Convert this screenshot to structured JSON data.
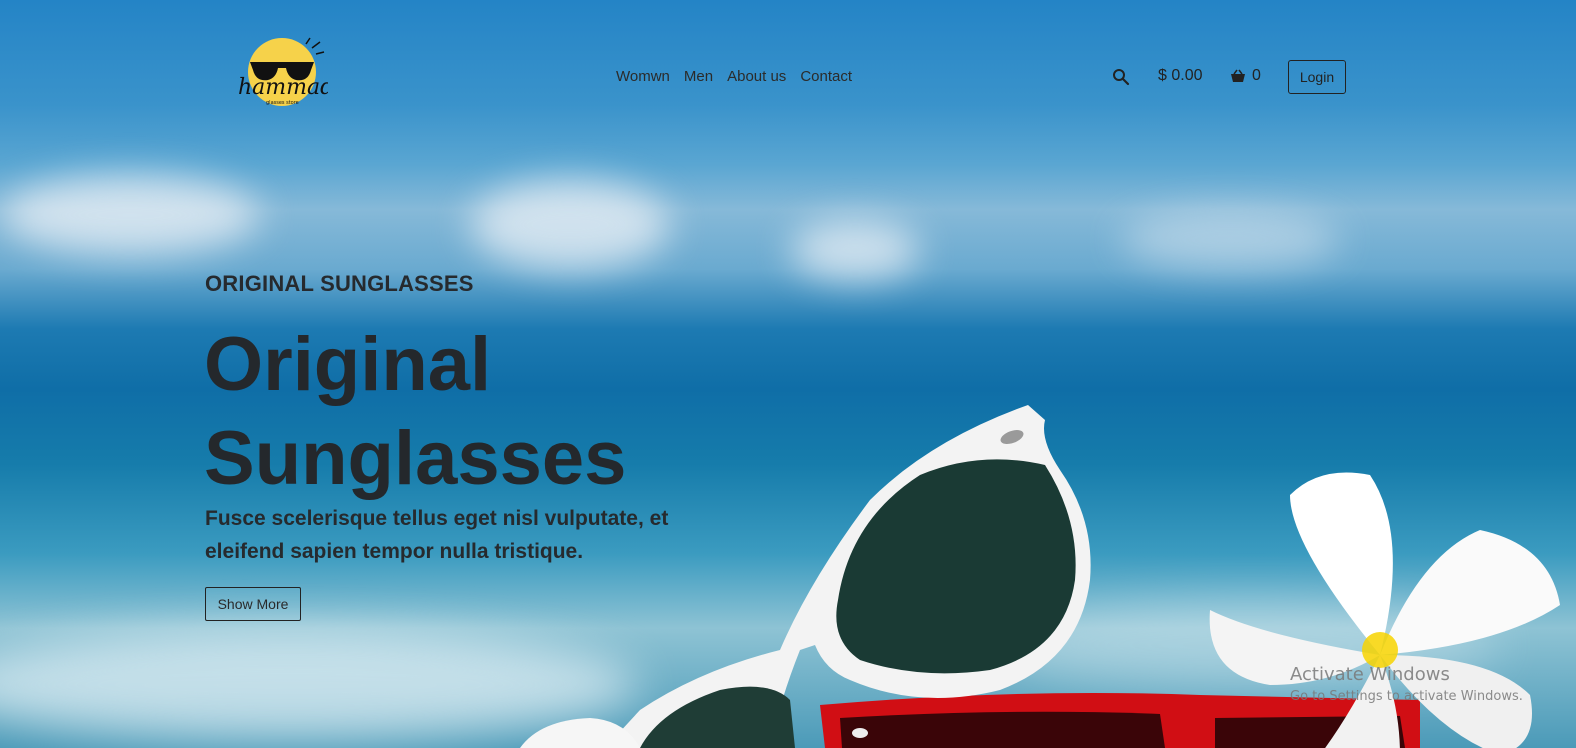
{
  "brand": {
    "logo_text": "hammad",
    "logo_tagline": "glasses store"
  },
  "nav": {
    "items": [
      "Womwn",
      "Men",
      "About us",
      "Contact"
    ]
  },
  "header": {
    "price": "$ 0.00",
    "cart_count": "0",
    "login_label": "Login"
  },
  "hero": {
    "kicker": "ORIGINAL SUNGLASSES",
    "headline_line1": "Original",
    "headline_line2": "Sunglasses",
    "subtitle": "Fusce scelerisque tellus eget nisl vulputate, et eleifend sapien tempor nulla tristique.",
    "button_label": "Show More"
  },
  "watermark": {
    "title": "Activate Windows",
    "subtitle": "Go to Settings to activate Windows."
  },
  "icons": {
    "search": "search-icon",
    "cart": "basket-icon"
  },
  "colors": {
    "sky": "#2484c6",
    "sea": "#0f6ea7",
    "text": "#24282c",
    "sun": "#f6d24a",
    "frame_red": "#d10e14"
  }
}
